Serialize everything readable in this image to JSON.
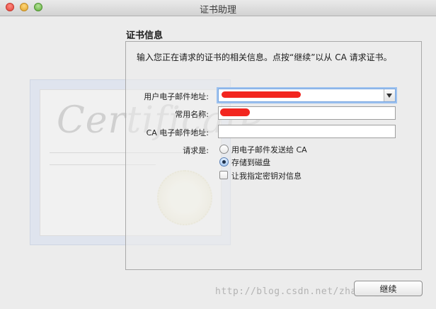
{
  "window": {
    "title": "证书助理"
  },
  "section": {
    "title": "证书信息",
    "intro": "输入您正在请求的证书的相关信息。点按“继续”以从 CA 请求证书。"
  },
  "form": {
    "email_label": "用户电子邮件地址:",
    "email_value": "",
    "common_name_label": "常用名称:",
    "common_name_value": "",
    "ca_email_label": "CA 电子邮件地址:",
    "ca_email_value": "",
    "request_label": "请求是:",
    "options": [
      {
        "label": "用电子邮件发送给 CA",
        "selected": false
      },
      {
        "label": "存储到磁盘",
        "selected": true
      }
    ],
    "checkbox_label": "让我指定密钥对信息",
    "checkbox_checked": false
  },
  "artwork": {
    "word": "Certificate"
  },
  "buttons": {
    "continue": "继续"
  },
  "watermark": "http://blog.csdn.net/zhaoxy_thu",
  "colors": {
    "redaction": "#f2261f",
    "focus_ring": "#9cc1ef"
  }
}
